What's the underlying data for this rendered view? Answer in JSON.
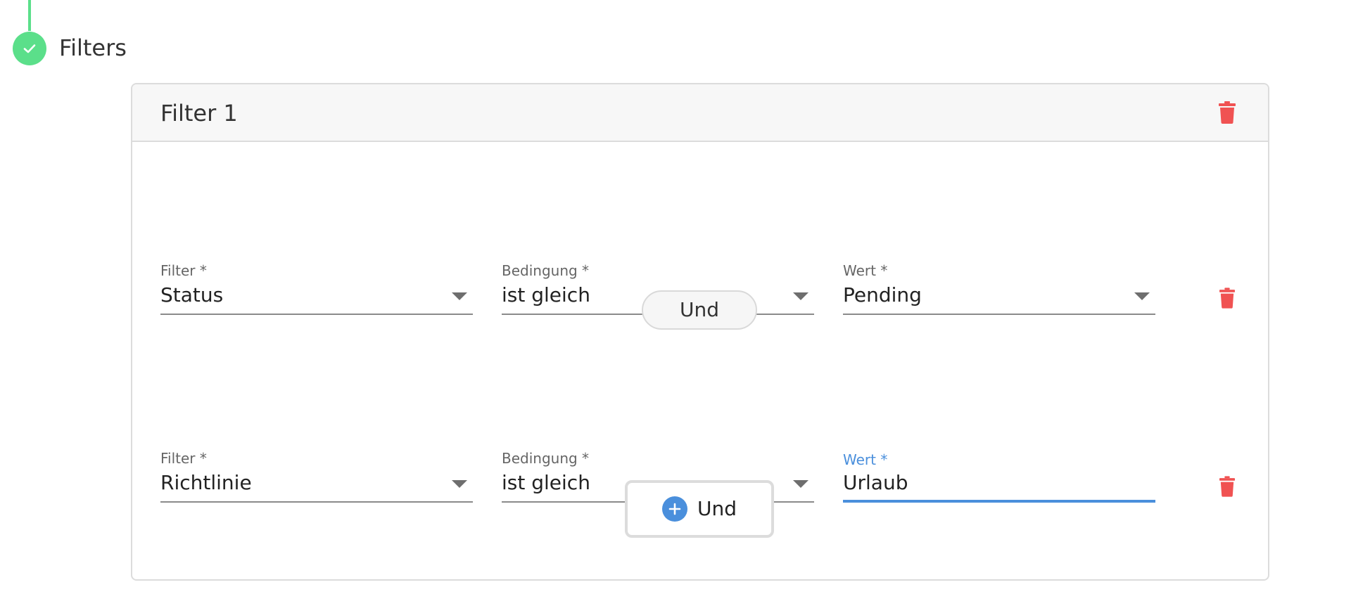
{
  "step": {
    "title": "Filters",
    "status_icon": "check-icon",
    "accent_color": "#5bdf8a"
  },
  "filter_group": {
    "title": "Filter 1",
    "delete_icon": "trash-icon",
    "delete_color": "#f05252",
    "conditions": [
      {
        "filter_label": "Filter *",
        "filter_value": "Status",
        "condition_label": "Bedingung *",
        "condition_value": "ist gleich",
        "value_label": "Wert *",
        "value_value": "Pending"
      },
      {
        "filter_label": "Filter *",
        "filter_value": "Richtlinie",
        "condition_label": "Bedingung *",
        "condition_value": "ist gleich",
        "value_label": "Wert *",
        "value_value": "Urlaub"
      }
    ],
    "connector_label": "Und",
    "add_button_label": "Und",
    "add_icon": "plus-circle-icon",
    "focus_color": "#4a8fdc"
  }
}
